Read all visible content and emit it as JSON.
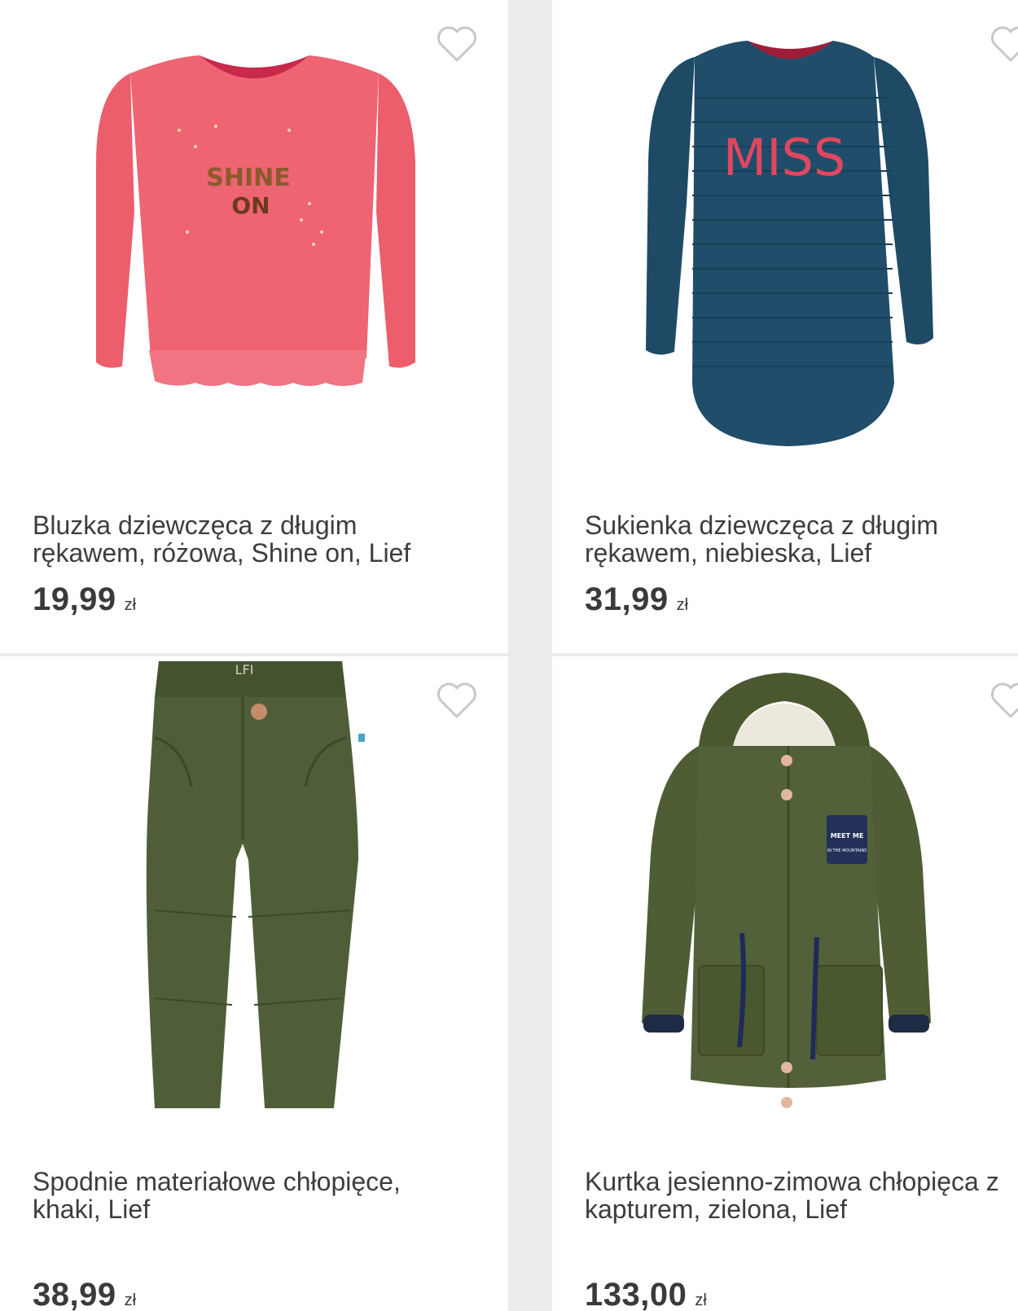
{
  "products": [
    {
      "title": "Bluzka dziewczęca z długim rękawem, różowa, Shine on, Lief",
      "price": "19,99",
      "currency": "zł",
      "print_text_1": "SHINE",
      "print_text_2": "ON",
      "color": "#ec5e6c"
    },
    {
      "title": "Sukienka dziewczęca z długim rękawem, niebieska, Lief",
      "price": "31,99",
      "currency": "zł",
      "print_text_1": "MISS",
      "color": "#1e4a66"
    },
    {
      "title": "Spodnie materiałowe chłopięce, khaki, Lief",
      "price": "38,99",
      "currency": "zł",
      "print_text_1": "LFI",
      "color": "#4b5a36"
    },
    {
      "title": "Kurtka jesienno-zimowa chłopięca z kapturem, zielona, Lief",
      "price": "133,00",
      "currency": "zł",
      "print_text_1": "MEET ME",
      "print_text_2": "IN THE MOUNTAINS",
      "color": "#4f5d35"
    }
  ],
  "icons": {
    "favorite": "heart-outline-icon"
  }
}
